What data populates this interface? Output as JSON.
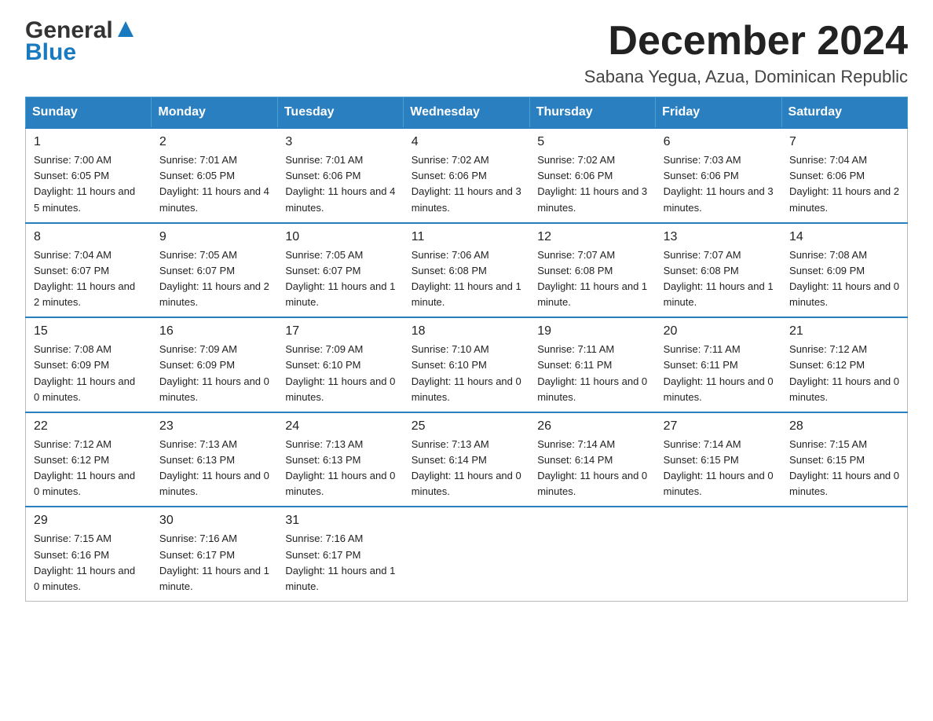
{
  "logo": {
    "general": "General",
    "blue": "Blue"
  },
  "header": {
    "month_year": "December 2024",
    "location": "Sabana Yegua, Azua, Dominican Republic"
  },
  "weekdays": [
    "Sunday",
    "Monday",
    "Tuesday",
    "Wednesday",
    "Thursday",
    "Friday",
    "Saturday"
  ],
  "weeks": [
    [
      {
        "day": "1",
        "sunrise": "7:00 AM",
        "sunset": "6:05 PM",
        "daylight": "11 hours and 5 minutes."
      },
      {
        "day": "2",
        "sunrise": "7:01 AM",
        "sunset": "6:05 PM",
        "daylight": "11 hours and 4 minutes."
      },
      {
        "day": "3",
        "sunrise": "7:01 AM",
        "sunset": "6:06 PM",
        "daylight": "11 hours and 4 minutes."
      },
      {
        "day": "4",
        "sunrise": "7:02 AM",
        "sunset": "6:06 PM",
        "daylight": "11 hours and 3 minutes."
      },
      {
        "day": "5",
        "sunrise": "7:02 AM",
        "sunset": "6:06 PM",
        "daylight": "11 hours and 3 minutes."
      },
      {
        "day": "6",
        "sunrise": "7:03 AM",
        "sunset": "6:06 PM",
        "daylight": "11 hours and 3 minutes."
      },
      {
        "day": "7",
        "sunrise": "7:04 AM",
        "sunset": "6:06 PM",
        "daylight": "11 hours and 2 minutes."
      }
    ],
    [
      {
        "day": "8",
        "sunrise": "7:04 AM",
        "sunset": "6:07 PM",
        "daylight": "11 hours and 2 minutes."
      },
      {
        "day": "9",
        "sunrise": "7:05 AM",
        "sunset": "6:07 PM",
        "daylight": "11 hours and 2 minutes."
      },
      {
        "day": "10",
        "sunrise": "7:05 AM",
        "sunset": "6:07 PM",
        "daylight": "11 hours and 1 minute."
      },
      {
        "day": "11",
        "sunrise": "7:06 AM",
        "sunset": "6:08 PM",
        "daylight": "11 hours and 1 minute."
      },
      {
        "day": "12",
        "sunrise": "7:07 AM",
        "sunset": "6:08 PM",
        "daylight": "11 hours and 1 minute."
      },
      {
        "day": "13",
        "sunrise": "7:07 AM",
        "sunset": "6:08 PM",
        "daylight": "11 hours and 1 minute."
      },
      {
        "day": "14",
        "sunrise": "7:08 AM",
        "sunset": "6:09 PM",
        "daylight": "11 hours and 0 minutes."
      }
    ],
    [
      {
        "day": "15",
        "sunrise": "7:08 AM",
        "sunset": "6:09 PM",
        "daylight": "11 hours and 0 minutes."
      },
      {
        "day": "16",
        "sunrise": "7:09 AM",
        "sunset": "6:09 PM",
        "daylight": "11 hours and 0 minutes."
      },
      {
        "day": "17",
        "sunrise": "7:09 AM",
        "sunset": "6:10 PM",
        "daylight": "11 hours and 0 minutes."
      },
      {
        "day": "18",
        "sunrise": "7:10 AM",
        "sunset": "6:10 PM",
        "daylight": "11 hours and 0 minutes."
      },
      {
        "day": "19",
        "sunrise": "7:11 AM",
        "sunset": "6:11 PM",
        "daylight": "11 hours and 0 minutes."
      },
      {
        "day": "20",
        "sunrise": "7:11 AM",
        "sunset": "6:11 PM",
        "daylight": "11 hours and 0 minutes."
      },
      {
        "day": "21",
        "sunrise": "7:12 AM",
        "sunset": "6:12 PM",
        "daylight": "11 hours and 0 minutes."
      }
    ],
    [
      {
        "day": "22",
        "sunrise": "7:12 AM",
        "sunset": "6:12 PM",
        "daylight": "11 hours and 0 minutes."
      },
      {
        "day": "23",
        "sunrise": "7:13 AM",
        "sunset": "6:13 PM",
        "daylight": "11 hours and 0 minutes."
      },
      {
        "day": "24",
        "sunrise": "7:13 AM",
        "sunset": "6:13 PM",
        "daylight": "11 hours and 0 minutes."
      },
      {
        "day": "25",
        "sunrise": "7:13 AM",
        "sunset": "6:14 PM",
        "daylight": "11 hours and 0 minutes."
      },
      {
        "day": "26",
        "sunrise": "7:14 AM",
        "sunset": "6:14 PM",
        "daylight": "11 hours and 0 minutes."
      },
      {
        "day": "27",
        "sunrise": "7:14 AM",
        "sunset": "6:15 PM",
        "daylight": "11 hours and 0 minutes."
      },
      {
        "day": "28",
        "sunrise": "7:15 AM",
        "sunset": "6:15 PM",
        "daylight": "11 hours and 0 minutes."
      }
    ],
    [
      {
        "day": "29",
        "sunrise": "7:15 AM",
        "sunset": "6:16 PM",
        "daylight": "11 hours and 0 minutes."
      },
      {
        "day": "30",
        "sunrise": "7:16 AM",
        "sunset": "6:17 PM",
        "daylight": "11 hours and 1 minute."
      },
      {
        "day": "31",
        "sunrise": "7:16 AM",
        "sunset": "6:17 PM",
        "daylight": "11 hours and 1 minute."
      },
      null,
      null,
      null,
      null
    ]
  ],
  "labels": {
    "sunrise": "Sunrise:",
    "sunset": "Sunset:",
    "daylight": "Daylight:"
  }
}
